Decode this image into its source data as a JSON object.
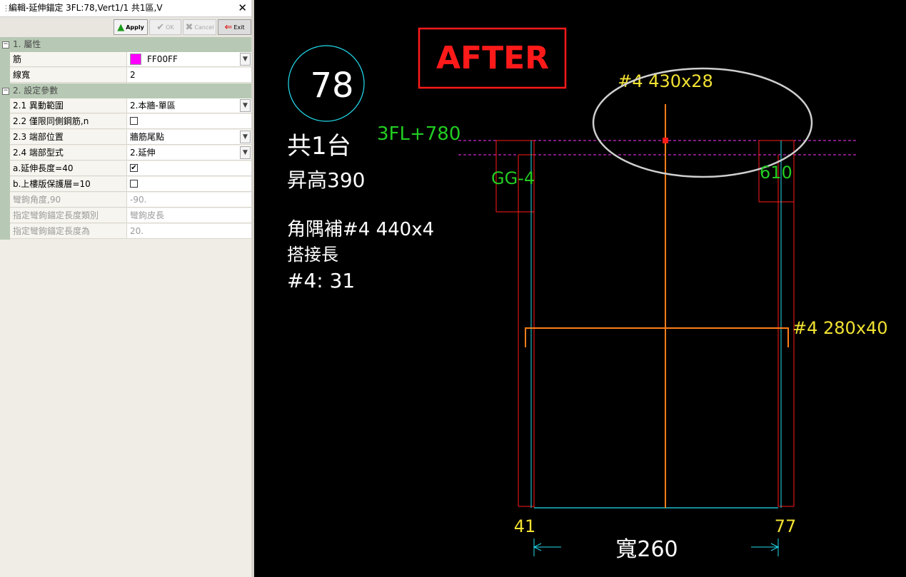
{
  "window": {
    "title": "編輯-延伸錨定 3FL:78,Vert1/1 共1區,V",
    "close_glyph": "✕"
  },
  "toolbar": {
    "apply_label": "Apply",
    "ok_label": "OK",
    "cancel_label": "Cancel",
    "exit_label": "Exit"
  },
  "properties": {
    "cat1": {
      "toggle": "−",
      "label": "1. 屬性"
    },
    "rebar": {
      "label": "筋",
      "value": "FF00FF",
      "color": "#FF00FF"
    },
    "line_width": {
      "label": "線寬",
      "value": "2"
    },
    "cat2": {
      "toggle": "−",
      "label": "2. 設定參數"
    },
    "range": {
      "label": "2.1 異動範圍",
      "value": "2.本牆-單區"
    },
    "same_side": {
      "label": "2.2 僅限同側鋼筋,n",
      "checked": false
    },
    "end_pos": {
      "label": "2.3 端部位置",
      "value": "牆筋尾點"
    },
    "end_type": {
      "label": "2.4 端部型式",
      "value": "2.延伸"
    },
    "ext_len": {
      "label": "a.延伸長度=40",
      "checked": true
    },
    "slab_cover": {
      "label": "b.上樓版保護層=10",
      "checked": false
    },
    "hook_angle": {
      "label": "彎鉤角度,90",
      "value": "-90."
    },
    "hook_len_type": {
      "label": "指定彎鉤錨定長度類別",
      "value": "彎鉤皮長"
    },
    "hook_len": {
      "label": "指定彎鉤錨定長度為",
      "value": "20."
    }
  },
  "drawing": {
    "circle_number": "78",
    "count": "共1台",
    "raise": "昇高390",
    "corner_rebar": "角隅補#4  440x4",
    "splice_title": "搭接長",
    "splice_value": "#4:  31",
    "after_label": "AFTER",
    "level_label": "3FL+780",
    "top_rebar": "#4  430x28",
    "left_beam": "GG-4",
    "right_beam": "610",
    "stirrup": "#4  280x40",
    "dim_left": "41",
    "dim_right": "77",
    "width_label": "寬260",
    "colors": {
      "text_white": "#FFFFFF",
      "green": "#22CC22",
      "yellow": "#F2E232",
      "red": "#FF1A1A",
      "orange": "#FF7F1A",
      "cyan": "#22DDEE",
      "magenta": "#FF33FF",
      "ellipse": "#CFCFCF"
    }
  }
}
